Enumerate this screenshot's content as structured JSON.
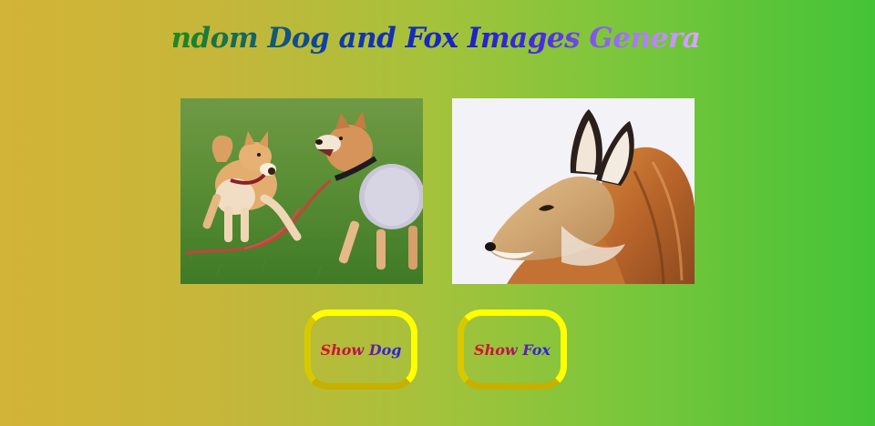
{
  "header": {
    "title": "Random Dog and Fox Images Generator"
  },
  "images": {
    "dog": {
      "alt": "dog"
    },
    "fox": {
      "alt": "fox"
    }
  },
  "buttons": {
    "show_dog_label": "Show Dog",
    "show_fox_label": "Show Fox"
  },
  "colors": {
    "background_left": "#d2b437",
    "background_right": "#44c337",
    "button_border": "#ffff00",
    "label_red": "#e0102a",
    "label_blue": "#2e20e0"
  }
}
